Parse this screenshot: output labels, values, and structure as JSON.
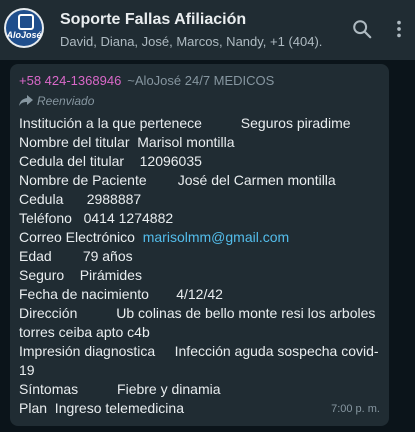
{
  "header": {
    "title": "Soporte Fallas Afiliación",
    "subtitle": "David, Diana, José, Marcos, Nandy, +1 (404)...",
    "avatar_text": "AloJosé"
  },
  "message": {
    "sender_phone": "+58 424-1368946",
    "sender_name": "~AloJosé 24/7 MEDICOS",
    "forwarded_label": "Reenviado",
    "lines": [
      {
        "text": "Institución a la que pertenece          Seguros piradime"
      },
      {
        "text": "Nombre del titular  Marisol montilla"
      },
      {
        "text": "Cedula del titular    12096035"
      },
      {
        "text": "Nombre de Paciente        José del Carmen montilla"
      },
      {
        "text": "Cedula      2988887"
      },
      {
        "text": "Teléfono   0414 1274882"
      },
      {
        "text": "Correo Electrónico  ",
        "link": "marisolmm@gmail.com"
      },
      {
        "text": "Edad        79 años"
      },
      {
        "text": "Seguro    Pirámides"
      },
      {
        "text": "Fecha de nacimiento       4/12/42"
      },
      {
        "text": "Dirección          Ub colinas de bello monte resi los arboles"
      },
      {
        "text": "torres ceiba apto c4b"
      },
      {
        "text": "Impresión diagnostica     Infección aguda sospecha covid-"
      },
      {
        "text": "19"
      },
      {
        "text": "Síntomas          Fiebre y dinamia"
      },
      {
        "text": "Plan  Ingreso telemedicina"
      }
    ],
    "timestamp": "7:00 p. m."
  },
  "colors": {
    "header_bg": "#202c33",
    "chat_bg": "#0b141a",
    "bubble_bg": "#202c33",
    "sender_phone": "#d868c8",
    "link": "#53bdeb"
  },
  "icons": [
    "search-icon",
    "more-vertical-icon",
    "forward-arrow-icon"
  ]
}
